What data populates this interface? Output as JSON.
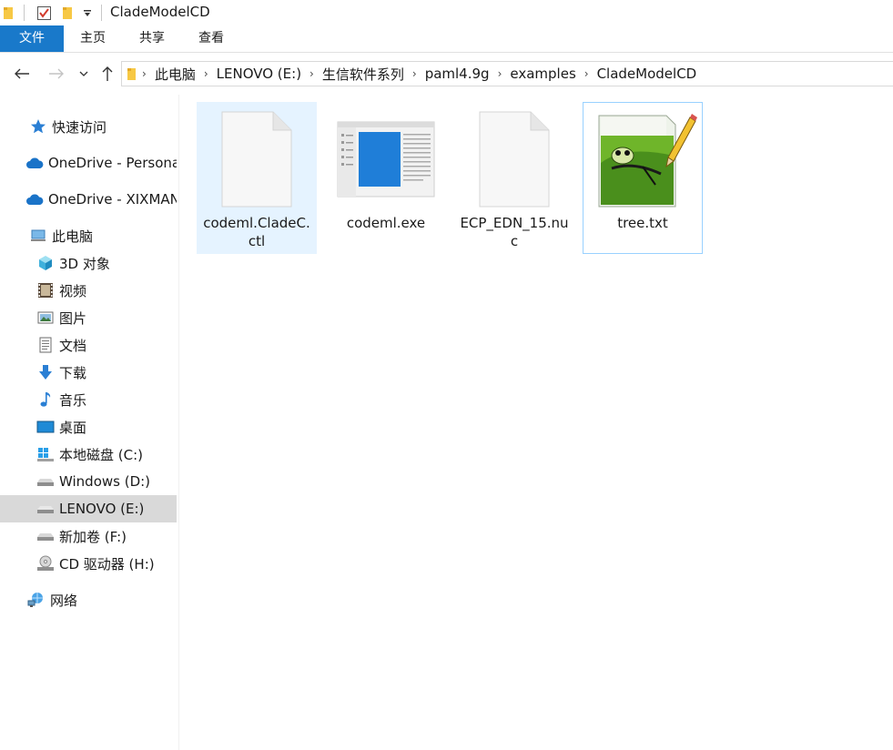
{
  "window": {
    "title": "CladeModelCD"
  },
  "ribbon": {
    "tabs": [
      "文件",
      "主页",
      "共享",
      "查看"
    ]
  },
  "address": {
    "crumbs": [
      "此电脑",
      "LENOVO (E:)",
      "生信软件系列",
      "paml4.9g",
      "examples",
      "CladeModelCD"
    ]
  },
  "sidebar": {
    "items": [
      {
        "label": "快速访问",
        "icon": "star-icon"
      },
      {
        "label": "OneDrive - Persona",
        "icon": "cloud-icon"
      },
      {
        "label": "OneDrive - XIXMAN",
        "icon": "cloud-icon"
      },
      {
        "label": "此电脑",
        "icon": "computer-icon"
      },
      {
        "label": "3D 对象",
        "icon": "cube-icon"
      },
      {
        "label": "视频",
        "icon": "film-icon"
      },
      {
        "label": "图片",
        "icon": "picture-icon"
      },
      {
        "label": "文档",
        "icon": "document-icon"
      },
      {
        "label": "下载",
        "icon": "download-icon"
      },
      {
        "label": "音乐",
        "icon": "music-icon"
      },
      {
        "label": "桌面",
        "icon": "desktop-icon"
      },
      {
        "label": "本地磁盘 (C:)",
        "icon": "windows-drive-icon"
      },
      {
        "label": "Windows (D:)",
        "icon": "drive-icon"
      },
      {
        "label": "LENOVO (E:)",
        "icon": "drive-icon",
        "selected": true
      },
      {
        "label": "新加卷 (F:)",
        "icon": "drive-icon"
      },
      {
        "label": "CD 驱动器 (H:)",
        "icon": "cd-drive-icon"
      },
      {
        "label": "网络",
        "icon": "network-icon"
      }
    ]
  },
  "files": [
    {
      "name": "codeml.CladeC.ctl",
      "icon": "blank-file-icon",
      "selected": true
    },
    {
      "name": "codeml.exe",
      "icon": "exe-window-icon"
    },
    {
      "name": "ECP_EDN_15.nuc",
      "icon": "blank-file-icon"
    },
    {
      "name": "tree.txt",
      "icon": "notepad-plus-plus-icon",
      "focused": true
    }
  ],
  "colors": {
    "accent": "#1979ca",
    "selected_bg": "#e5f3ff",
    "focus_border": "#99d1ff",
    "sidebar_selected": "#d9d9d9"
  }
}
